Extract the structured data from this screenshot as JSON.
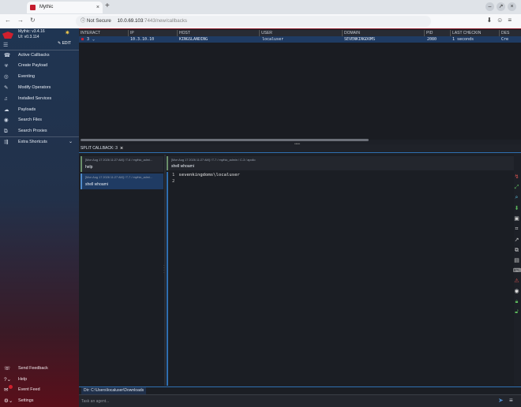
{
  "browser": {
    "tab_title": "Mythic",
    "tab_close": "×",
    "new_tab": "+",
    "not_secure": "Not Secure",
    "host": "10.0.69.103",
    "path": ":7443/new/callbacks"
  },
  "sidebar": {
    "version_mythic": "Mythic: v3.4.16",
    "version_ui": "UI: v0.3.114",
    "edit_label": "EDIT",
    "items": [
      {
        "label": "Active Callbacks",
        "icon": "phone-icon"
      },
      {
        "label": "Create Payload",
        "icon": "biohazard-icon"
      },
      {
        "label": "Eventing",
        "icon": "target-icon"
      },
      {
        "label": "Modify Operators",
        "icon": "pencil-icon"
      },
      {
        "label": "Installed Services",
        "icon": "headphones-icon"
      },
      {
        "label": "Payloads",
        "icon": "cloud-icon"
      },
      {
        "label": "Search Files",
        "icon": "eye-icon"
      },
      {
        "label": "Search Proxies",
        "icon": "proxy-icon"
      },
      {
        "label": "Extra Shortcuts",
        "icon": "shortcut-icon"
      }
    ],
    "bottom": [
      {
        "label": "Send Feedback",
        "icon": "feedback-icon"
      },
      {
        "label": "Help",
        "icon": "help-icon"
      },
      {
        "label": "Event Feed",
        "icon": "event-feed-icon"
      },
      {
        "label": "Settings",
        "icon": "settings-icon"
      }
    ]
  },
  "table": {
    "columns": [
      "INTERACT",
      "IP",
      "HOST",
      "USER",
      "DOMAIN",
      "PID",
      "LAST CHECKIN",
      "DES"
    ],
    "row": {
      "interact": "3",
      "ip": "10.3.10.10",
      "host": "KINGSLANDING",
      "user": "localuser",
      "domain": "SEVENKINGDOMS",
      "pid": "2080",
      "last_checkin": "1 seconds",
      "desc": "Cre"
    }
  },
  "split": {
    "label": "SPLIT CALLBACK: 3",
    "close": "×"
  },
  "tasks": [
    {
      "meta": "[Mon Aug 17 2026 11:27 AM] / T-6 / mythic_admi…",
      "cmd": "help"
    },
    {
      "meta": "[Mon Aug 17 2026 11:27 AM] / T-7 / mythic_admi…",
      "cmd": "shell whoami"
    }
  ],
  "output": {
    "meta": "[Mon Aug 17 2026 11:27 AM] / T-7 / mythic_admin / C-3 / apollo",
    "cmd": "shell whoami",
    "lines": [
      {
        "n": "1",
        "text": "sevenkingdoms\\localuser"
      },
      {
        "n": "2",
        "text": ""
      }
    ]
  },
  "input": {
    "dir_label": "Dir: C:\\Users\\localuser\\Downloads",
    "placeholder": "Task an agent..."
  },
  "colors": {
    "accent": "#2f6fb0",
    "brand_red": "#d0202e",
    "selected_row": "#1f3b63"
  }
}
